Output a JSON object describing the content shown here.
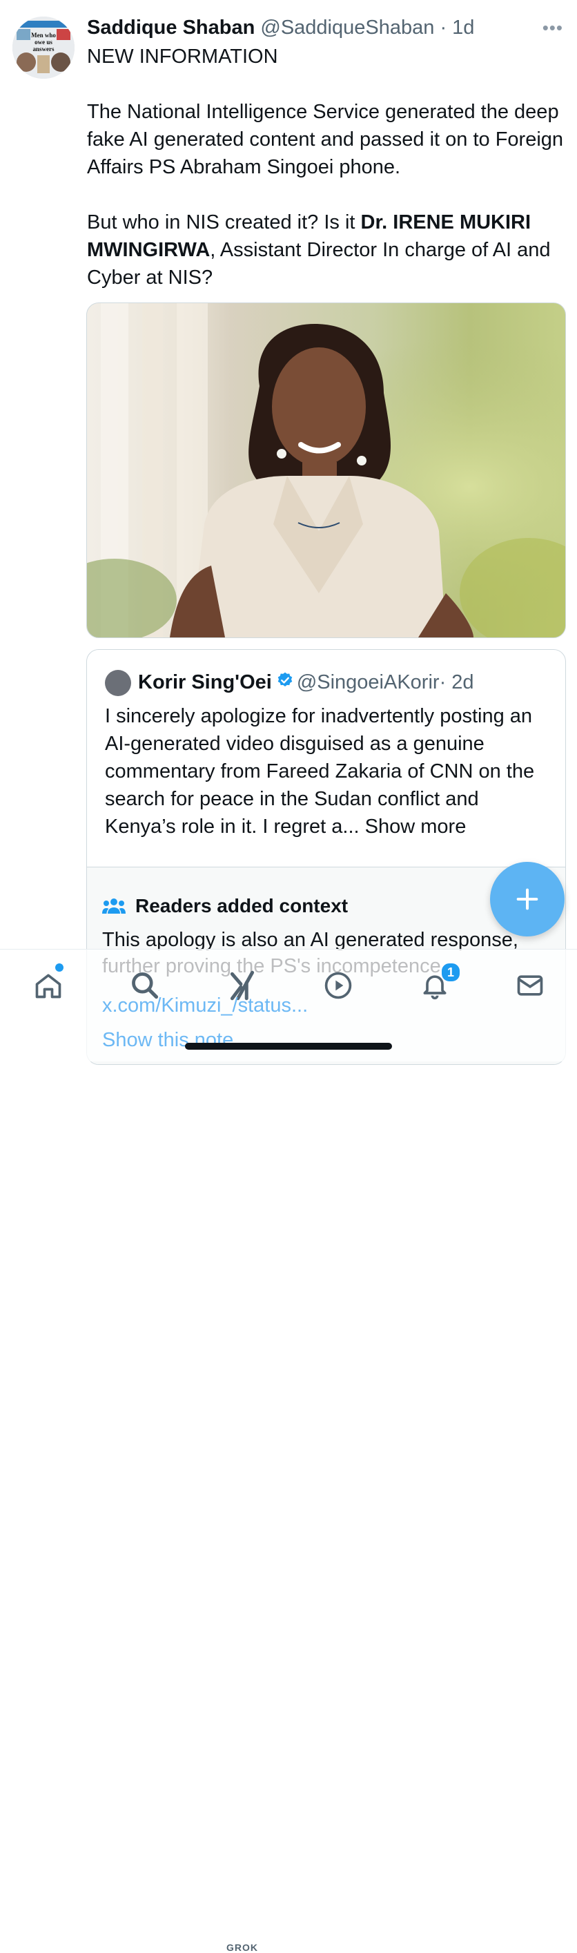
{
  "tweet": {
    "author_name": "Saddique Shaban",
    "author_handle": "@SaddiqueShaban",
    "time": "· 1d",
    "more_icon": "more-dots-icon",
    "line1": "NEW INFORMATION",
    "para2": "The National Intelligence Service generated the deep fake AI generated content and passed it on to  Foreign Affairs PS Abraham Singoei phone.",
    "para3_start": " But who in NIS created it? Is it ",
    "para3_bold1": "Dr. IRENE MUKIRI",
    "para3_bold2": "MWINGIRWA",
    "para3_end": ", Assistant Director In charge of AI and Cyber at NIS?",
    "avatar_text_line1": "Men who",
    "avatar_text_line2": "owe us",
    "avatar_text_line3": "answers"
  },
  "quote": {
    "author_name": "Korir Sing'Oei",
    "author_handle": "@SingoeiAKorir",
    "time": "· 2d",
    "text": "I sincerely apologize for inadvertently posting an AI-generated video disguised as a genuine commentary from Fareed Zakaria of CNN on the search for peace in the Sudan conflict and Kenya’s role in it. I regret a...",
    "show_more": "Show more",
    "verified_icon": "verified-badge-icon"
  },
  "context": {
    "title": "Readers added context",
    "text": "This apology is also an AI generated response, further proving the PS's incompetence.",
    "link": "x.com/Kimuzi_/status...",
    "show_note": "Show this note"
  },
  "tabbar": {
    "grok_label": "GROK",
    "notifications_count": "1"
  },
  "colors": {
    "accent": "#1d9bf0",
    "text": "#0f1419",
    "muted": "#536471"
  }
}
